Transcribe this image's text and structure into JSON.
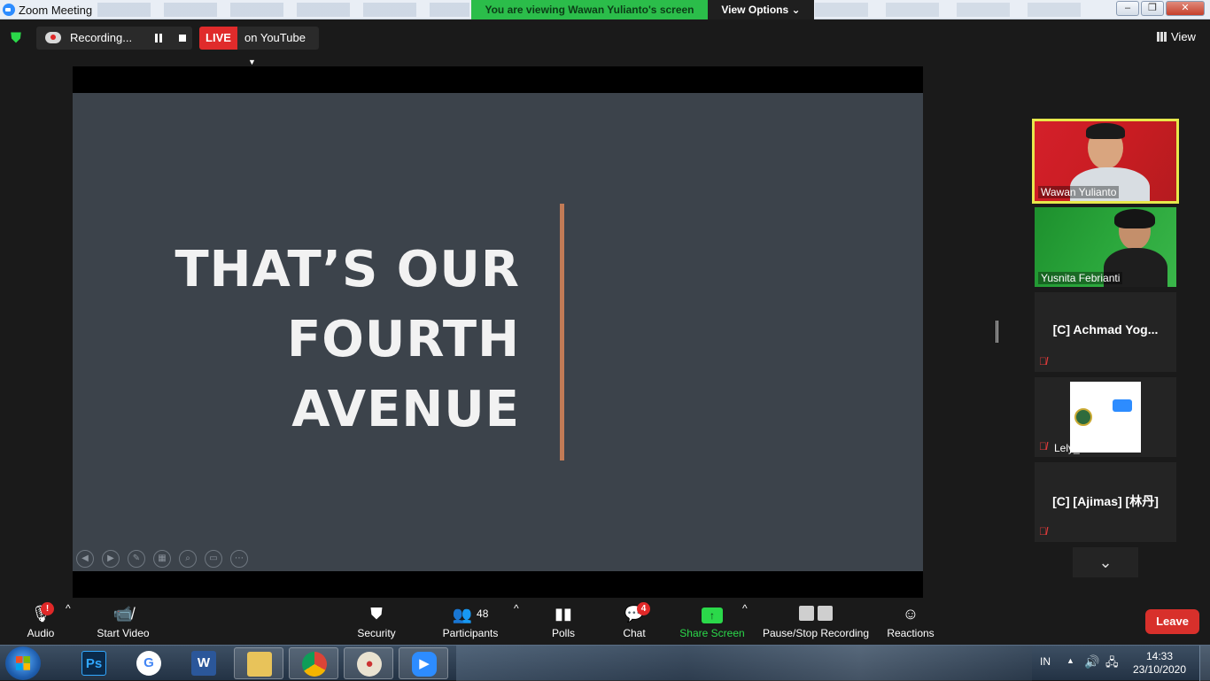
{
  "window": {
    "title": "Zoom Meeting",
    "viewing_banner": "You are viewing Wawan Yulianto's screen",
    "view_options": "View Options",
    "view_options_caret": "⌄"
  },
  "topbar": {
    "recording_label": "Recording...",
    "live_label": "LIVE",
    "youtube_label": "on YouTube",
    "view_label": "View"
  },
  "slide": {
    "lines": [
      "THAT’S OUR",
      "FOURTH",
      "AVENUE"
    ],
    "accent_color": "#c27b56",
    "background": "#3c434b"
  },
  "participants": [
    {
      "name": "Wawan Yulianto",
      "video": true,
      "active_speaker": true
    },
    {
      "name": "Yusnita Febrianti",
      "video": true
    },
    {
      "name": "[C]  Achmad Yog...",
      "video": false,
      "muted": true
    },
    {
      "name": "Lely_OIA HI U...",
      "video": false,
      "muted": true,
      "image": "oia-logo"
    },
    {
      "name": "[C]  [Ajimas]  [林丹]",
      "video": false,
      "muted": true
    }
  ],
  "toolbar": {
    "audio": "Audio",
    "audio_alert": "!",
    "start_video": "Start Video",
    "security": "Security",
    "participants": "Participants",
    "participants_count": "48",
    "polls": "Polls",
    "chat": "Chat",
    "chat_badge": "4",
    "share_screen": "Share Screen",
    "pause_stop_recording": "Pause/Stop Recording",
    "reactions": "Reactions",
    "leave": "Leave"
  },
  "taskbar": {
    "apps": [
      "start",
      "photoshop",
      "google",
      "word",
      "file-explorer",
      "chrome",
      "paint",
      "zoom"
    ],
    "photoshop_label": "Ps",
    "word_label": "W",
    "language": "IN",
    "time": "14:33",
    "date": "23/10/2020"
  },
  "colors": {
    "zoom_blue": "#2d8cff",
    "live_red": "#e02b2b",
    "green": "#2bd94a",
    "leave_red": "#d8302b",
    "speaker_border": "#e7e84b"
  }
}
